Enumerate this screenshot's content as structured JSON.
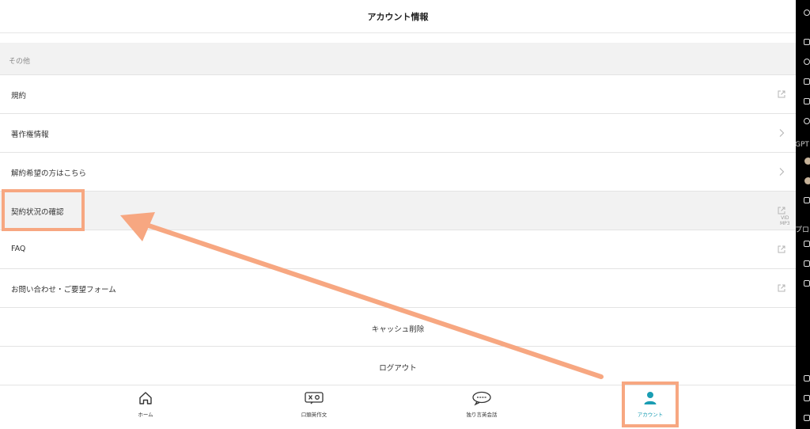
{
  "header": {
    "title": "アカウント情報"
  },
  "section": {
    "label": "その他"
  },
  "menu": [
    {
      "label": "規約",
      "icon": "external-link-icon"
    },
    {
      "label": "著作権情報",
      "icon": "chevron-right-icon"
    },
    {
      "label": "解約希望の方はこちら",
      "icon": "chevron-right-icon"
    },
    {
      "label": "契約状況の確認",
      "icon": "external-link-icon"
    },
    {
      "label": "FAQ",
      "icon": "external-link-icon"
    },
    {
      "label": "お問い合わせ・ご要望フォーム",
      "icon": "external-link-icon"
    }
  ],
  "actions": {
    "clear_cache": "キャッシュ削除",
    "logout": "ログアウト"
  },
  "tabs": [
    {
      "label": "ホーム",
      "icon": "home-icon"
    },
    {
      "label": "口頭英作文",
      "icon": "chat-x-icon"
    },
    {
      "label": "独り言英会話",
      "icon": "speech-bubble-icon"
    },
    {
      "label": "アカウント",
      "icon": "person-icon"
    }
  ],
  "sidebar": {
    "gpt_text": "GPT",
    "pro_text": "プロ"
  },
  "badge": {
    "line1": "VID",
    "line2": "MP3"
  },
  "colors": {
    "accent": "#1a9db3",
    "annotation": "#f7a781"
  }
}
